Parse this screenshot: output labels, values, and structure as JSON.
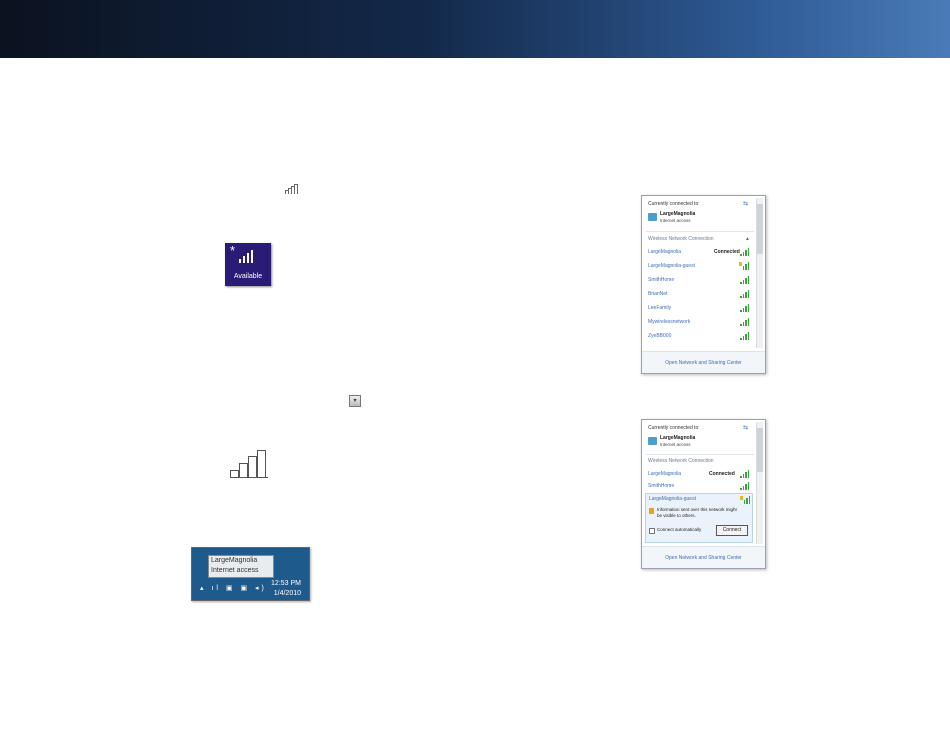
{
  "screenshot_1": {
    "refresh_icon": "refresh-arrows-icon",
    "current_label": "Currently connected to:",
    "current_network": {
      "name": "LargeMagnolia",
      "status": "Internet access",
      "icon": "network-icon"
    },
    "section_label": "Wireless Network Connection",
    "networks": [
      {
        "name": "LargeMagnolia",
        "status": "Connected",
        "secured": false
      },
      {
        "name": "LargeMagnolia-guest",
        "status": "",
        "secured": true
      },
      {
        "name": "SmithHome",
        "status": "",
        "secured": false
      },
      {
        "name": "BrianNet",
        "status": "",
        "secured": false
      },
      {
        "name": "LeeFamily",
        "status": "",
        "secured": false
      },
      {
        "name": "Mywirelessnetwork",
        "status": "",
        "secured": false
      },
      {
        "name": "ZyeBB000",
        "status": "",
        "secured": false
      }
    ],
    "footer_link": "Open Network and Sharing Center"
  },
  "screenshot_2": {
    "refresh_icon": "refresh-arrows-icon",
    "current_label": "Currently connected to:",
    "current_network": {
      "name": "LargeMagnolia",
      "status": "Internet access",
      "icon": "network-icon"
    },
    "section_label": "Wireless Network Connection",
    "networks": [
      {
        "name": "LargeMagnolia",
        "status": "Connected",
        "secured": false
      },
      {
        "name": "SmithHome",
        "status": "",
        "secured": false
      }
    ],
    "selected_network": {
      "name": "LargeMagnolia-guest",
      "warning": "Information sent over this network might be visible to others.",
      "auto_connect_label": "Connect automatically",
      "connect_button": "Connect"
    },
    "footer_link": "Open Network and Sharing Center"
  },
  "available_tile": {
    "label": "Available",
    "icon": "wifi-available-icon"
  },
  "tray": {
    "tooltip_name": "LargeMagnolia",
    "tooltip_status": "Internet access",
    "time": "12:53 PM",
    "date": "1/4/2010"
  },
  "colors": {
    "header_dark": "#0b1220",
    "header_light": "#4a7bb8",
    "tile_background": "#2a1b77",
    "taskbar": "#1f5a8c",
    "link_blue": "#3e6db5",
    "signal_green": "#3aa33a"
  }
}
